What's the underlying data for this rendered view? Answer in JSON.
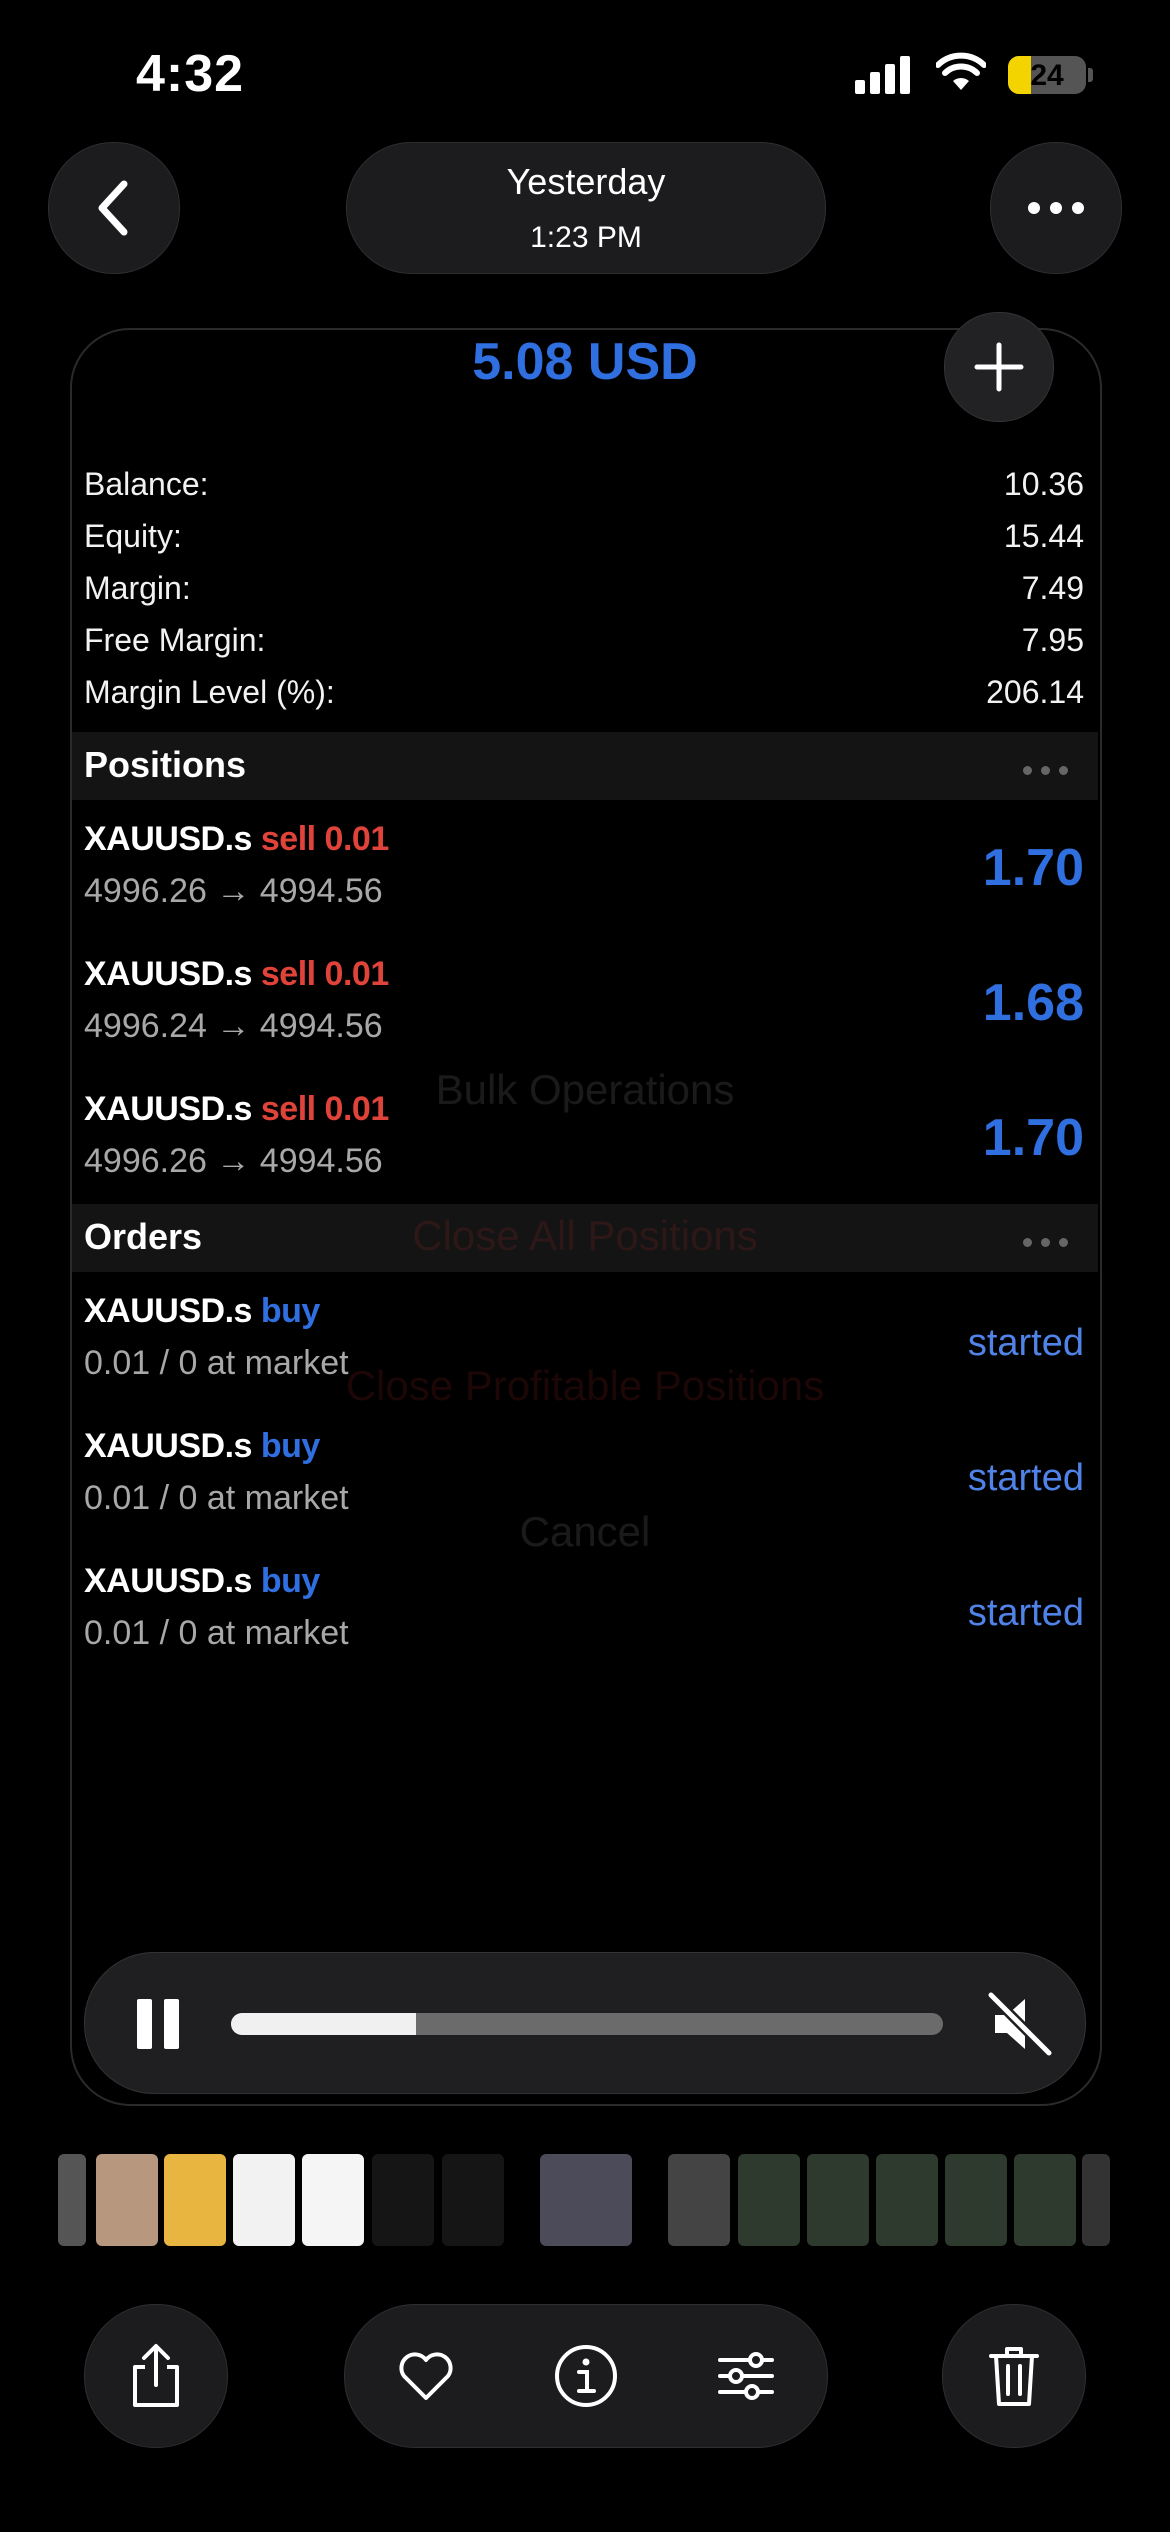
{
  "status_bar": {
    "time": "4:32",
    "battery": "24"
  },
  "header": {
    "date": "Yesterday",
    "time": "1:23 PM"
  },
  "account": {
    "profit": "5.08 USD",
    "rows": [
      {
        "label": "Balance:",
        "value": "10.36"
      },
      {
        "label": "Equity:",
        "value": "15.44"
      },
      {
        "label": "Margin:",
        "value": "7.49"
      },
      {
        "label": "Free Margin:",
        "value": "7.95"
      },
      {
        "label": "Margin Level (%):",
        "value": "206.14"
      }
    ]
  },
  "positions": {
    "title": "Positions",
    "items": [
      {
        "symbol": "XAUUSD.s",
        "side": "sell 0.01",
        "prices": "4996.26 → 4994.56",
        "profit": "1.70"
      },
      {
        "symbol": "XAUUSD.s",
        "side": "sell 0.01",
        "prices": "4996.24 → 4994.56",
        "profit": "1.68"
      },
      {
        "symbol": "XAUUSD.s",
        "side": "sell 0.01",
        "prices": "4996.26 → 4994.56",
        "profit": "1.70"
      }
    ]
  },
  "orders": {
    "title": "Orders",
    "items": [
      {
        "symbol": "XAUUSD.s",
        "side": "buy",
        "details": "0.01 / 0 at market",
        "status": "started"
      },
      {
        "symbol": "XAUUSD.s",
        "side": "buy",
        "details": "0.01 / 0 at market",
        "status": "started"
      },
      {
        "symbol": "XAUUSD.s",
        "side": "buy",
        "details": "0.01 / 0 at market",
        "status": "started"
      }
    ]
  },
  "overlay_menu": {
    "title": "Bulk Operations",
    "close_all": "Close All Positions",
    "close_profitable": "Close Profitable Positions",
    "cancel": "Cancel"
  },
  "player": {
    "progress": 0.26,
    "state": "playing",
    "muted": true
  },
  "colors": {
    "accent_blue": "#2f6fe0",
    "sell_red": "#e0433a",
    "battery_yellow": "#f3d400"
  },
  "icons": [
    "back-icon",
    "more-icon",
    "plus-icon",
    "pause-icon",
    "mute-icon",
    "share-icon",
    "heart-icon",
    "info-icon",
    "sliders-icon",
    "trash-icon"
  ]
}
